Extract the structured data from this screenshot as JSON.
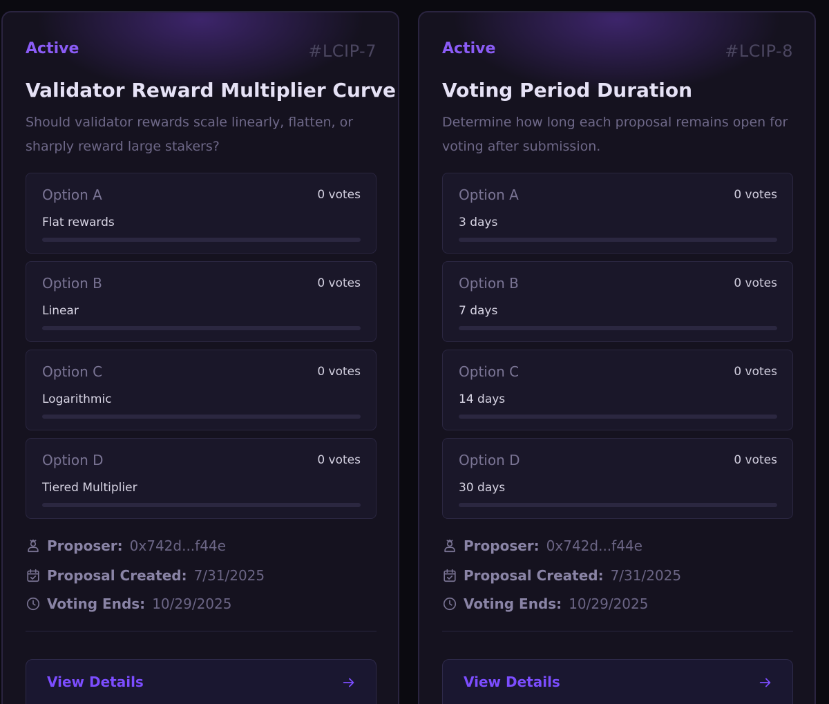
{
  "cards": [
    {
      "status": "Active",
      "id": "#LCIP-7",
      "title": "Validator Reward Multiplier Curve",
      "description": "Should validator rewards scale linearly, flatten, or sharply reward large stakers?",
      "options": [
        {
          "label": "Option A",
          "votes": "0 votes",
          "text": "Flat rewards",
          "progress": 0
        },
        {
          "label": "Option B",
          "votes": "0 votes",
          "text": "Linear",
          "progress": 0
        },
        {
          "label": "Option C",
          "votes": "0 votes",
          "text": "Logarithmic",
          "progress": 0
        },
        {
          "label": "Option D",
          "votes": "0 votes",
          "text": "Tiered Multiplier",
          "progress": 0
        }
      ],
      "proposer_label": "Proposer:",
      "proposer": "0x742d...f44e",
      "created_label": "Proposal Created:",
      "created": "7/31/2025",
      "ends_label": "Voting Ends:",
      "ends": "10/29/2025",
      "details_label": "View Details"
    },
    {
      "status": "Active",
      "id": "#LCIP-8",
      "title": "Voting Period Duration",
      "description": "Determine how long each proposal remains open for voting after submission.",
      "options": [
        {
          "label": "Option A",
          "votes": "0 votes",
          "text": "3 days",
          "progress": 0
        },
        {
          "label": "Option B",
          "votes": "0 votes",
          "text": "7 days",
          "progress": 0
        },
        {
          "label": "Option C",
          "votes": "0 votes",
          "text": "14 days",
          "progress": 0
        },
        {
          "label": "Option D",
          "votes": "0 votes",
          "text": "30 days",
          "progress": 0
        }
      ],
      "proposer_label": "Proposer:",
      "proposer": "0x742d...f44e",
      "created_label": "Proposal Created:",
      "created": "7/31/2025",
      "ends_label": "Voting Ends:",
      "ends": "10/29/2025",
      "details_label": "View Details"
    }
  ],
  "colors": {
    "accent": "#7c4dff",
    "status": "#8b5cf6",
    "background": "#0b0a10",
    "card": "#15121f"
  },
  "icons": {
    "proposer": "user-icon",
    "created": "calendar-check-icon",
    "ends": "clock-icon",
    "details": "arrow-right-icon"
  }
}
